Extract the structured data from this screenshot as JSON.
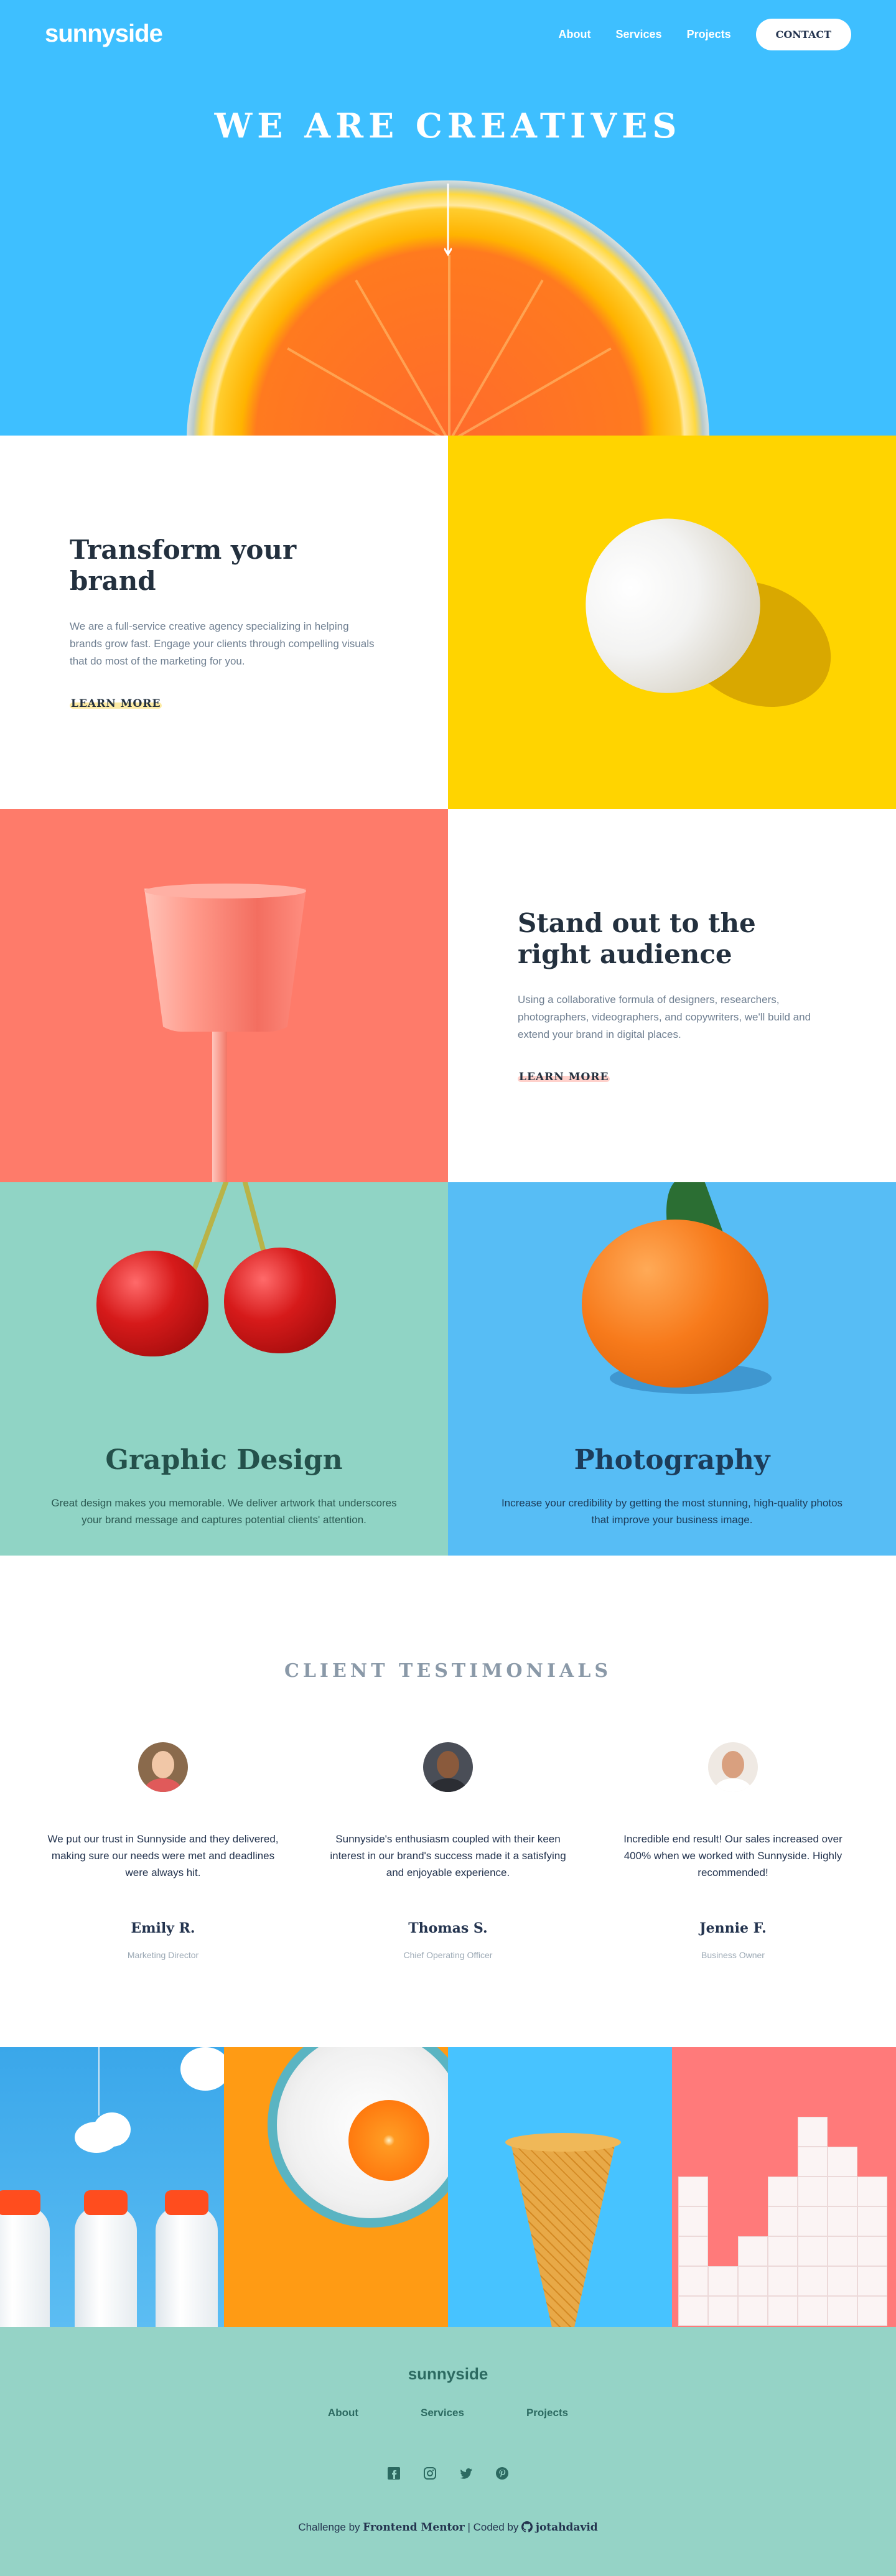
{
  "header": {
    "logo": "sunnyside",
    "nav": [
      "About",
      "Services",
      "Projects"
    ],
    "contact": "CONTACT"
  },
  "hero": {
    "title": "WE ARE CREATIVES"
  },
  "features": [
    {
      "title": "Transform your brand",
      "body": "We are a full-service creative agency specializing in helping brands grow fast. Engage your clients through compelling visuals that do most of the marketing for you.",
      "cta": "LEARN MORE"
    },
    {
      "title": "Stand out to the right audience",
      "body": "Using a collaborative formula of designers, researchers, photographers, videographers, and copywriters, we'll build and extend your brand in digital places.",
      "cta": "LEARN MORE"
    }
  ],
  "services": [
    {
      "title": "Graphic Design",
      "body": "Great design makes you memorable. We deliver artwork that underscores your brand message and captures potential clients' attention."
    },
    {
      "title": "Photography",
      "body": "Increase your credibility by getting the most stunning, high-quality photos that improve your business image."
    }
  ],
  "testimonials": {
    "title": "CLIENT TESTIMONIALS",
    "items": [
      {
        "quote": "We put our trust in Sunnyside and they delivered, making sure our needs were met and deadlines were always hit.",
        "name": "Emily R.",
        "role": "Marketing Director"
      },
      {
        "quote": "Sunnyside's enthusiasm coupled with their keen interest in our brand's success made it a satisfying and enjoyable experience.",
        "name": "Thomas S.",
        "role": "Chief Operating Officer"
      },
      {
        "quote": "Incredible end result! Our sales increased over 400% when we worked with Sunnyside. Highly recommended!",
        "name": "Jennie F.",
        "role": "Business Owner"
      }
    ]
  },
  "footer": {
    "logo": "sunnyside",
    "nav": [
      "About",
      "Services",
      "Projects"
    ],
    "social_icons": [
      "facebook-icon",
      "instagram-icon",
      "twitter-icon",
      "pinterest-icon"
    ],
    "attribution": {
      "challenge_by": "Challenge by",
      "fm": "Frontend Mentor",
      "sep": "|",
      "coded_by": "Coded by",
      "author": "jotahdavid"
    }
  },
  "colors": {
    "hero_blue": "#3ebfff",
    "yellow": "#ffd400",
    "coral": "#fe7b6a",
    "mint": "#90d4c5",
    "sky": "#57bdf5",
    "footer_mint": "#95d3c6",
    "dark_text": "#24344f"
  }
}
